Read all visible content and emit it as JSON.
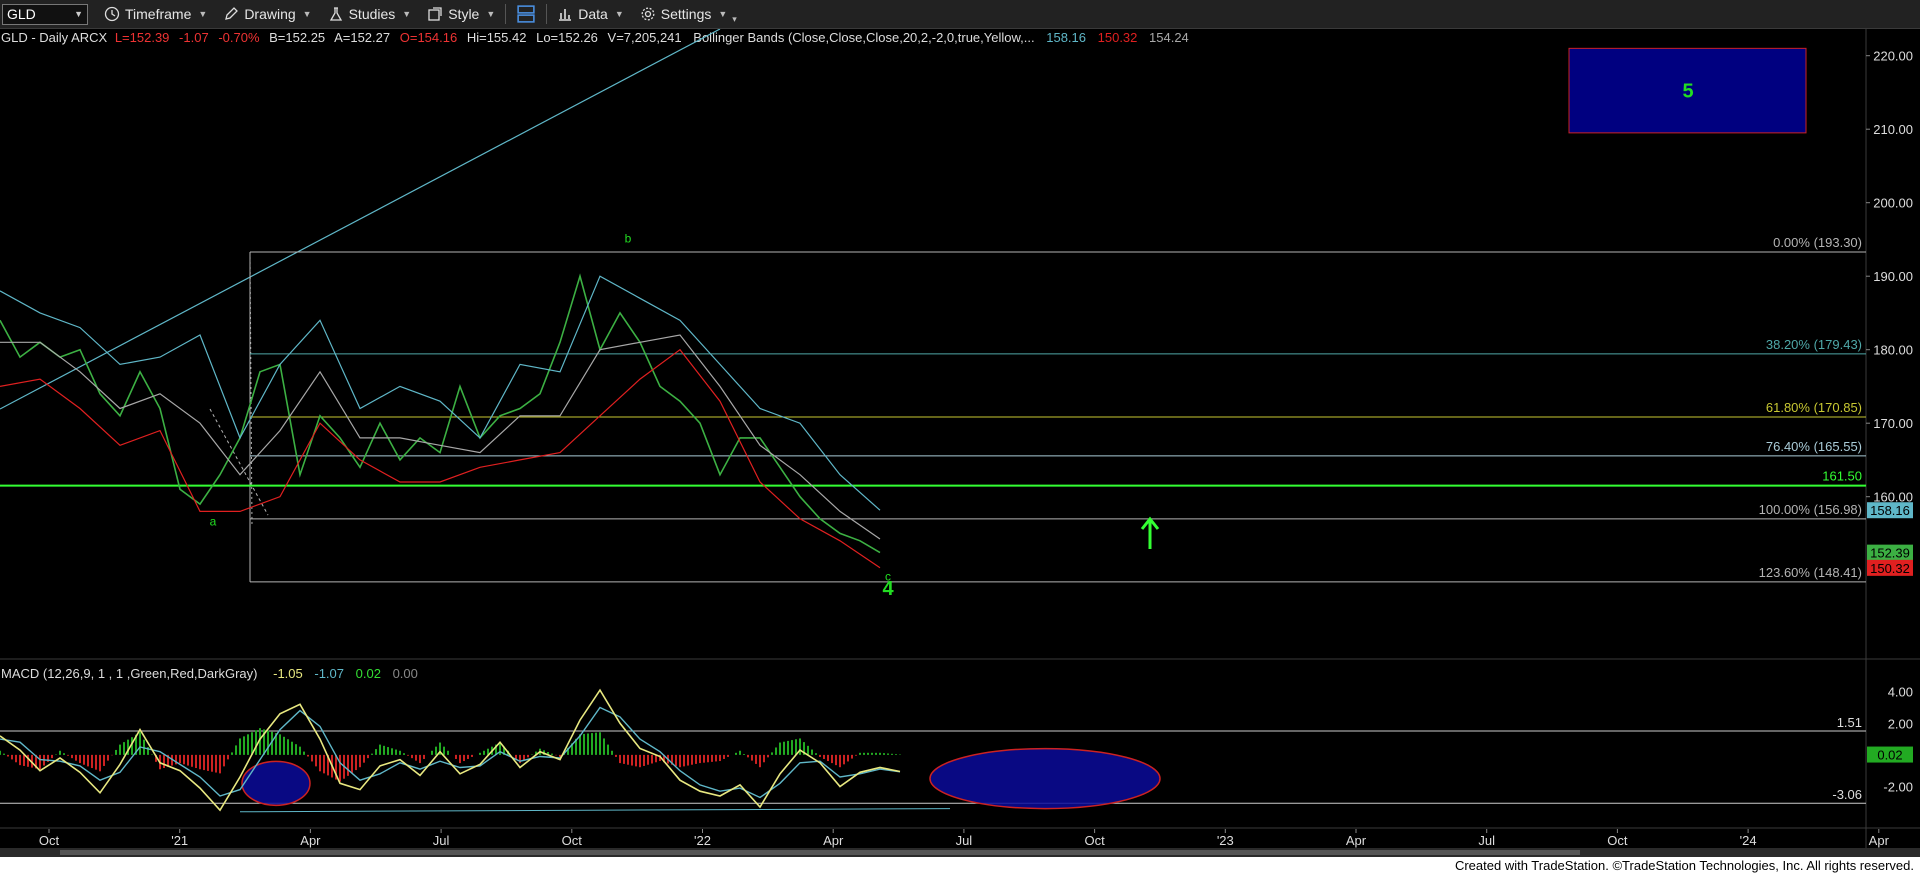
{
  "toolbar": {
    "symbol": "GLD",
    "timeframe": "Timeframe",
    "drawing": "Drawing",
    "studies": "Studies",
    "style": "Style",
    "data": "Data",
    "settings": "Settings"
  },
  "legend": {
    "symbol": "GLD - Daily  ARCX",
    "last": "L=152.39",
    "chg": "-1.07",
    "pct": "-0.70%",
    "bid": "B=152.25",
    "ask": "A=152.27",
    "open": "O=154.16",
    "high": "Hi=155.42",
    "low": "Lo=152.26",
    "vol": "V=7,205,241",
    "study": "Bollinger Bands (Close,Close,Close,20,2,-2,0,true,Yellow,...",
    "upper": "158.16",
    "lower": "150.32",
    "mid": "154.24"
  },
  "macd_legend": {
    "name": "MACD (12,26,9, 1 , 1 ,Green,Red,DarkGray)",
    "v1": "-1.05",
    "v2": "-1.07",
    "v3": "0.02",
    "v4": "0.00"
  },
  "footer": "Created with TradeStation. ©TradeStation Technologies, Inc. All rights reserved.",
  "colors": {
    "background": "#000000",
    "price": "#3cb043",
    "upper_band": "#5fb7c8",
    "lower_band": "#e02020",
    "mid_band": "#a8a8a8",
    "fib": "#b4b4b4",
    "wave_label": "#22dd22",
    "support": "#33ff33",
    "target_box": "#000080",
    "macd_line": "#e8e880",
    "signal_line": "#5fb7c8",
    "macd_hist_pos": "#22aa22",
    "macd_hist_neg": "#cc2222"
  },
  "chart_data": [
    {
      "type": "line",
      "title": "GLD - Daily",
      "x_ticks": [
        "Oct",
        "'21",
        "Apr",
        "Jul",
        "Oct",
        "'22",
        "Apr",
        "Jul",
        "Oct",
        "'23",
        "Apr",
        "Jul",
        "Oct",
        "'24",
        "Apr"
      ],
      "ylim": [
        142,
        222
      ],
      "y_ticks": [
        160,
        170,
        180,
        190,
        200,
        210,
        220
      ],
      "price_axis_tags": [
        {
          "label": "158.16",
          "value": 158.16,
          "color": "#5fb7c8"
        },
        {
          "label": "152.39",
          "value": 152.39,
          "color": "#3cb043"
        },
        {
          "label": "150.32",
          "value": 150.32,
          "color": "#e02020"
        }
      ],
      "series": [
        {
          "role": "price",
          "x": [
            0,
            20,
            40,
            60,
            80,
            100,
            120,
            140,
            160,
            180,
            200,
            220,
            240,
            260,
            280,
            300,
            320,
            340,
            360,
            380,
            400,
            420,
            440,
            460,
            480,
            500,
            520,
            540,
            560,
            580,
            600,
            620,
            640,
            660,
            680,
            700,
            720,
            740,
            760,
            780,
            800,
            820,
            840,
            860,
            880
          ],
          "values": [
            184,
            179,
            181,
            179,
            180,
            174,
            171,
            177,
            172,
            161,
            159,
            163,
            168,
            177,
            178,
            163,
            171,
            168,
            164,
            170,
            165,
            168,
            166,
            175,
            168,
            171,
            172,
            174,
            181,
            190,
            180,
            185,
            181,
            175,
            173,
            170,
            163,
            168,
            168,
            164,
            160,
            157,
            155,
            154,
            152.39
          ]
        },
        {
          "role": "upper_band",
          "x": [
            0,
            40,
            80,
            120,
            160,
            200,
            240,
            280,
            320,
            360,
            400,
            440,
            480,
            520,
            560,
            600,
            640,
            680,
            720,
            760,
            800,
            840,
            880
          ],
          "values": [
            188,
            185,
            183,
            178,
            179,
            182,
            168,
            178,
            184,
            172,
            175,
            173,
            168,
            178,
            177,
            190,
            187,
            184,
            178,
            172,
            170,
            163,
            158.16
          ]
        },
        {
          "role": "lower_band",
          "x": [
            0,
            40,
            80,
            120,
            160,
            200,
            240,
            280,
            320,
            360,
            400,
            440,
            480,
            520,
            560,
            600,
            640,
            680,
            720,
            760,
            800,
            840,
            880
          ],
          "values": [
            175,
            176,
            172,
            167,
            169,
            158,
            158,
            160,
            170,
            165,
            162,
            162,
            164,
            165,
            166,
            171,
            176,
            180,
            173,
            162,
            157,
            154,
            150.32
          ]
        },
        {
          "role": "mid_band",
          "x": [
            0,
            40,
            80,
            120,
            160,
            200,
            240,
            280,
            320,
            360,
            400,
            440,
            480,
            520,
            560,
            600,
            640,
            680,
            720,
            760,
            800,
            840,
            880
          ],
          "values": [
            181,
            181,
            177,
            172,
            174,
            170,
            163,
            169,
            177,
            168,
            168,
            167,
            166,
            171,
            171,
            180,
            181,
            182,
            175,
            167,
            163,
            158,
            154.24
          ]
        }
      ],
      "fibonacci": [
        {
          "label": "0.00% (193.30)",
          "value": 193.3
        },
        {
          "label": "38.20% (179.43)",
          "value": 179.43
        },
        {
          "label": "61.80% (170.85)",
          "value": 170.85
        },
        {
          "label": "76.40% (165.55)",
          "value": 165.55
        },
        {
          "label": "100.00% (156.98)",
          "value": 156.98
        },
        {
          "label": "123.60% (148.41)",
          "value": 148.41
        }
      ],
      "support_line": {
        "label": "161.50",
        "value": 161.5
      },
      "wave_labels": [
        {
          "label": "a",
          "x": 213,
          "value": 156.1
        },
        {
          "label": "b",
          "x": 628,
          "value": 194.6
        },
        {
          "label": "c",
          "x": 888,
          "value": 148.6
        },
        {
          "label": "4",
          "x": 888,
          "value": 146.6
        }
      ],
      "target_box": {
        "label": "5",
        "low": 209.5,
        "high": 221
      }
    },
    {
      "type": "line",
      "title": "MACD (12,26,9, 1 , 1 ,Green,Red,DarkGray)",
      "ylim": [
        -4.5,
        4.8
      ],
      "y_ticks": [
        -2.0,
        2.0,
        4.0
      ],
      "y_tick_labels": [
        "-2.00",
        "2.00",
        "4.00"
      ],
      "reference_lines": [
        {
          "label": "1.51",
          "value": 1.51
        },
        {
          "label": "-3.06",
          "value": -3.06
        }
      ],
      "axis_tag": {
        "label": "0.02",
        "value": 0.02
      },
      "series": [
        {
          "role": "macd",
          "x": [
            0,
            20,
            40,
            60,
            80,
            100,
            120,
            140,
            160,
            180,
            200,
            220,
            240,
            260,
            280,
            300,
            320,
            340,
            360,
            380,
            400,
            420,
            440,
            460,
            480,
            500,
            520,
            540,
            560,
            580,
            600,
            620,
            640,
            660,
            680,
            700,
            720,
            740,
            760,
            780,
            800,
            820,
            840,
            860,
            880,
            900
          ],
          "values": [
            1.2,
            0.3,
            -1.0,
            -0.2,
            -1.1,
            -2.4,
            -0.6,
            1.6,
            -0.5,
            -1.0,
            -2.1,
            -3.5,
            -1.4,
            1.0,
            2.6,
            3.2,
            1.0,
            -1.8,
            -2.2,
            -0.7,
            -0.3,
            -1.3,
            0.2,
            -1.2,
            -0.6,
            0.8,
            -0.8,
            0.2,
            -0.3,
            2.2,
            4.1,
            2.0,
            0.4,
            -0.1,
            -1.6,
            -2.3,
            -2.6,
            -1.9,
            -3.3,
            -1.2,
            0.3,
            -0.5,
            -2.0,
            -1.1,
            -0.8,
            -1.05
          ]
        },
        {
          "role": "signal",
          "x": [
            0,
            20,
            40,
            60,
            80,
            100,
            120,
            140,
            160,
            180,
            200,
            220,
            240,
            260,
            280,
            300,
            320,
            340,
            360,
            380,
            400,
            420,
            440,
            460,
            480,
            500,
            520,
            540,
            560,
            580,
            600,
            620,
            640,
            660,
            680,
            700,
            720,
            740,
            760,
            780,
            800,
            820,
            840,
            860,
            880,
            900
          ],
          "values": [
            1.0,
            0.8,
            -0.3,
            -0.4,
            -0.7,
            -1.6,
            -1.1,
            0.5,
            0.2,
            -0.6,
            -1.4,
            -2.6,
            -2.2,
            -0.3,
            1.6,
            2.8,
            1.8,
            -0.5,
            -1.6,
            -1.2,
            -0.5,
            -0.9,
            -0.4,
            -0.8,
            -0.7,
            0.2,
            -0.4,
            -0.1,
            -0.2,
            1.2,
            3.0,
            2.4,
            1.0,
            0.2,
            -1.0,
            -1.9,
            -2.3,
            -2.1,
            -2.7,
            -1.8,
            -0.5,
            -0.4,
            -1.4,
            -1.2,
            -0.9,
            -1.07
          ]
        }
      ]
    }
  ]
}
